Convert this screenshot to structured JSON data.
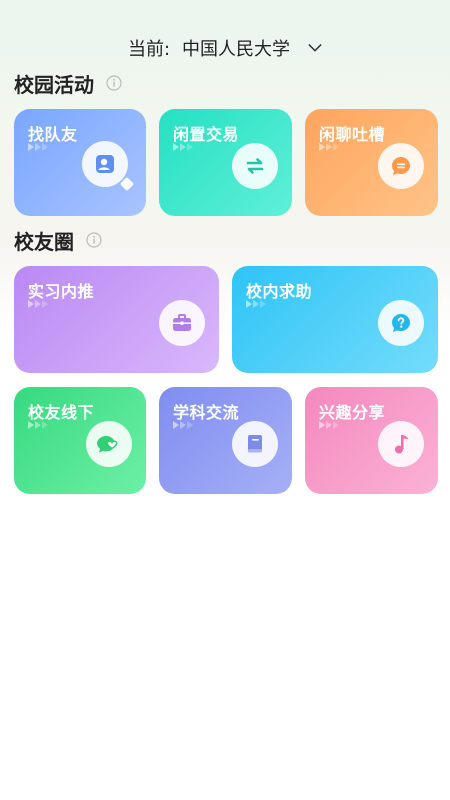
{
  "header": {
    "campus_prefix": "当前:",
    "campus_name": "中国人民大学",
    "dropdown_icon": "chevron-down-icon"
  },
  "sections": {
    "campus_activities": {
      "title": "校园活动",
      "info_icon": "info-icon"
    },
    "alumni_circle": {
      "title": "校友圈",
      "info_icon": "info-icon"
    }
  },
  "cards": {
    "find_teammates": {
      "label": "找队友",
      "icon": "find-user-icon",
      "color": "#7aa8ff"
    },
    "idle_trade": {
      "label": "闲置交易",
      "icon": "exchange-arrows-icon",
      "color": "#2fe0c8"
    },
    "chat": {
      "label": "闲聊吐槽",
      "icon": "chat-bubble-icon",
      "color": "#ffb06a"
    },
    "internship": {
      "label": "实习内推",
      "icon": "briefcase-icon",
      "color": "#c79cf6"
    },
    "campus_help": {
      "label": "校内求助",
      "icon": "question-bubble-icon",
      "color": "#3fc8f7"
    },
    "offline_meetup": {
      "label": "校友线下",
      "icon": "heart-chat-icon",
      "color": "#47de8a"
    },
    "academic": {
      "label": "学科交流",
      "icon": "book-icon",
      "color": "#8f9cf2"
    },
    "interest": {
      "label": "兴趣分享",
      "icon": "music-note-icon",
      "color": "#f79ac7"
    }
  }
}
